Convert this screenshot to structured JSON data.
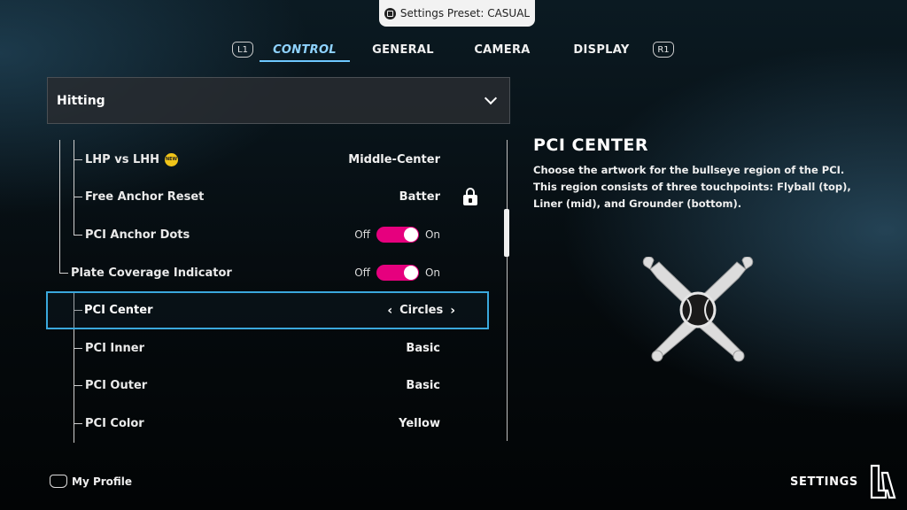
{
  "preset": {
    "label": "Settings Preset: CASUAL",
    "icon": "touchpad-icon"
  },
  "tabs": {
    "left_bumper": "L1",
    "right_bumper": "R1",
    "items": [
      {
        "label": "CONTROL",
        "active": true
      },
      {
        "label": "GENERAL",
        "active": false
      },
      {
        "label": "CAMERA",
        "active": false
      },
      {
        "label": "DISPLAY",
        "active": false
      }
    ]
  },
  "category": {
    "selected": "Hitting"
  },
  "settings": [
    {
      "label": "LHP vs LHH",
      "value": "Middle-Center",
      "badge": "NEW"
    },
    {
      "label": "Free Anchor Reset",
      "value": "Batter",
      "locked": true
    },
    {
      "label": "PCI Anchor Dots",
      "toggle_off": "Off",
      "toggle_on": "On",
      "state": "On"
    },
    {
      "label": "Plate Coverage Indicator",
      "toggle_off": "Off",
      "toggle_on": "On",
      "state": "On"
    },
    {
      "label": "PCI Center",
      "value": "Circles",
      "selected": true
    },
    {
      "label": "PCI Inner",
      "value": "Basic"
    },
    {
      "label": "PCI Outer",
      "value": "Basic"
    },
    {
      "label": "PCI Color",
      "value": "Yellow"
    }
  ],
  "info": {
    "title": "PCI CENTER",
    "description": "Choose the artwork for the bullseye region of the PCI. This region consists of three touchpoints: Flyball (top), Liner (mid), and Grounder (bottom).",
    "art_icon": "crossed-bats-baseball-icon"
  },
  "footer": {
    "profile_label": "My Profile",
    "screen_label": "SETTINGS",
    "logo": "la-dodgers-logo"
  },
  "colors": {
    "accent": "#6ec8ff",
    "toggle": "#e6007e",
    "selection": "#3aa8dc"
  }
}
